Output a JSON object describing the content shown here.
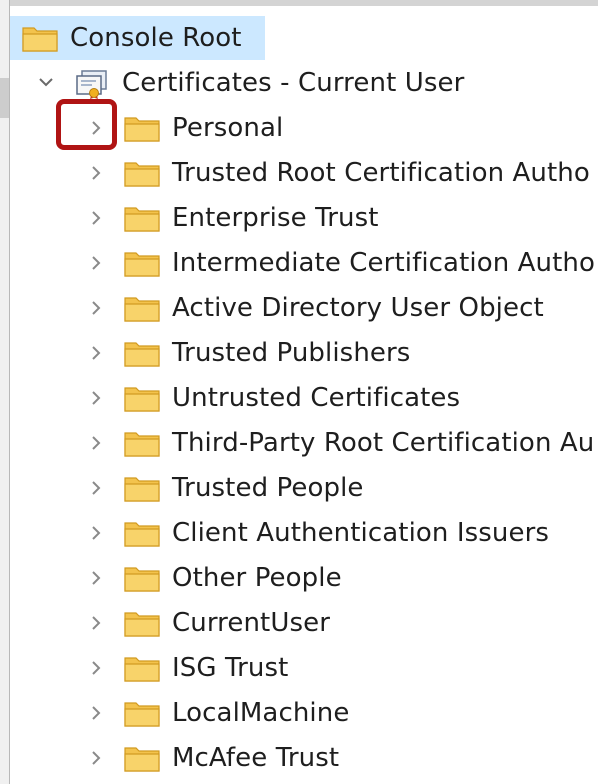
{
  "tree": {
    "root": {
      "label": "Console Root",
      "icon": "folder-icon"
    },
    "store": {
      "label": "Certificates - Current User",
      "icon": "certificate-store-icon",
      "expanded": true
    },
    "children": [
      {
        "label": "Personal"
      },
      {
        "label": "Trusted Root Certification Autho"
      },
      {
        "label": "Enterprise Trust"
      },
      {
        "label": "Intermediate Certification Autho"
      },
      {
        "label": "Active Directory User Object"
      },
      {
        "label": "Trusted Publishers"
      },
      {
        "label": "Untrusted Certificates"
      },
      {
        "label": "Third-Party Root Certification Au"
      },
      {
        "label": "Trusted People"
      },
      {
        "label": "Client Authentication Issuers"
      },
      {
        "label": "Other People"
      },
      {
        "label": "CurrentUser"
      },
      {
        "label": "ISG Trust"
      },
      {
        "label": "LocalMachine"
      },
      {
        "label": "McAfee Trust"
      }
    ]
  },
  "annotation": {
    "highlighted_item": "Personal expand arrow",
    "color": "#b01414"
  },
  "colors": {
    "selection": "#cce8ff",
    "folder": "#f3c34d",
    "text": "#1e1e1e"
  }
}
